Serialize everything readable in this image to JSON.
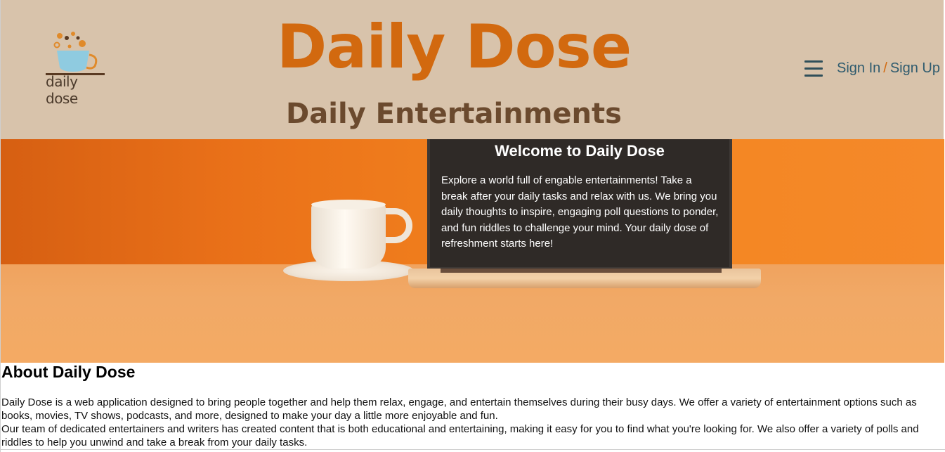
{
  "header": {
    "logo_text": "daily dose",
    "title": "Daily Dose",
    "subtitle": "Daily Entertainments",
    "sign_in": "Sign In",
    "separator": "/",
    "sign_up": "Sign Up",
    "menu_icon": "hamburger-icon"
  },
  "hero": {
    "title": "Welcome to Daily Dose",
    "text": "Explore a world full of engable entertainments! Take a break after your daily tasks and relax with us. We bring you daily thoughts to inspire, engaging poll questions to ponder, and fun riddles to challenge your mind. Your daily dose of refreshment starts here!"
  },
  "about": {
    "title": "About Daily Dose",
    "paragraph_1": "Daily Dose is a web application designed to bring people together and help them relax, engage, and entertain themselves during their busy days. We offer a variety of entertainment options such as books, movies, TV shows, podcasts, and more, designed to make your day a little more enjoyable and fun.",
    "paragraph_2": "Our team of dedicated entertainers and writers has created content that is both educational and entertaining, making it easy for you to find what you're looking for. We also offer a variety of polls and riddles to help you unwind and take a break from your daily tasks."
  },
  "colors": {
    "header_bg": "#d8c3ab",
    "brand_orange": "#d2690f",
    "brand_brown": "#6b4a2e",
    "link_teal": "#2f5b6e"
  }
}
